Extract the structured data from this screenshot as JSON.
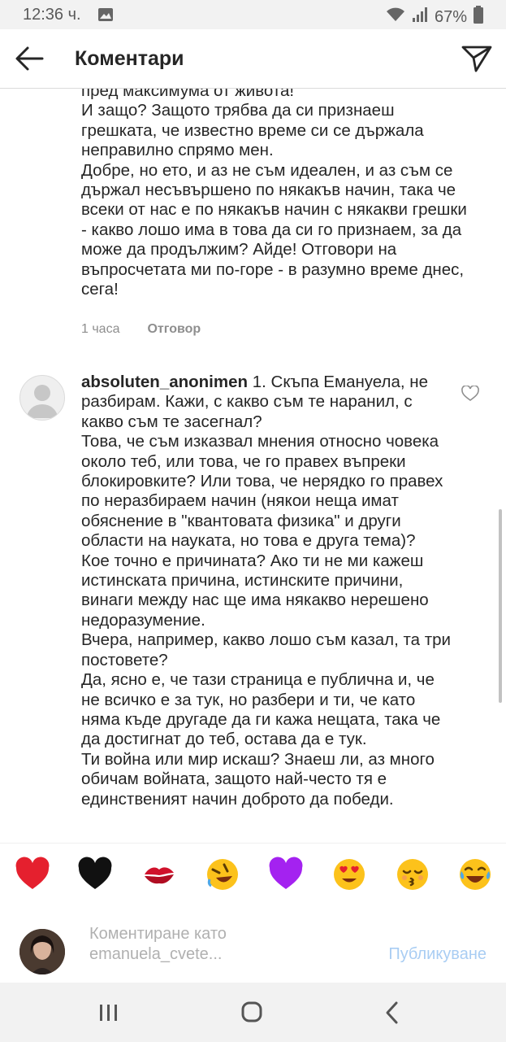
{
  "status_bar": {
    "time": "12:36 ч.",
    "battery": "67%"
  },
  "header": {
    "title": "Коментари"
  },
  "comments": [
    {
      "text": "пред максимума от живота!\nИ защо? Защото трябва да си признаеш грешката, че известно време си се държала неправилно спрямо мен.\nДобре, но ето, и аз не съм идеален, и аз съм се държал несъвършено по някакъв начин, така че всеки от нас е по някакъв начин с някакви грешки - какво лошо има в това да си го признаем, за да може да продължим? Айде! Отговори на въпросчетата ми по-горе - в разумно време днес, сега!",
      "time": "1 часа",
      "reply_label": "Отговор"
    },
    {
      "username": "absoluten_anonimen",
      "text": " 1. Скъпа Емануела, не разбирам. Кажи, с какво съм те наранил, с какво съм те засегнал?\nТова, че съм изказвал мнения относно човека около теб, или това, че го правех въпреки блокировките? Или това, че нерядко го правех по неразбираем начин (някои неща имат обяснение в \"квантовата физика\" и други области на науката, но това е друга тема)?\nКое точно е причината? Ако ти не ми кажеш истинската причина, истинските причини, винаги между нас ще има някакво нерешено недоразумение.\nВчера, например, какво лошо съм казал, та три постовете?\nДа, ясно е, че тази страница е публична и, че не всичко е за тук, но разбери и ти, че като няма къде другаде да ги кажа нещата, така че да достигнат до теб, остава да е тук.\nТи война или мир искаш? Знаеш ли, аз много обичам войната, защото най-често тя е единственият начин доброто да победи."
    }
  ],
  "emoji_bar": [
    "red-heart",
    "black-heart",
    "kiss-mark",
    "rolling-laughing",
    "purple-heart",
    "heart-eyes",
    "kissing-closed-eyes",
    "tears-of-joy"
  ],
  "compose": {
    "placeholder": "Коментиране като emanuela_cvete...",
    "publish_label": "Публикуване"
  }
}
